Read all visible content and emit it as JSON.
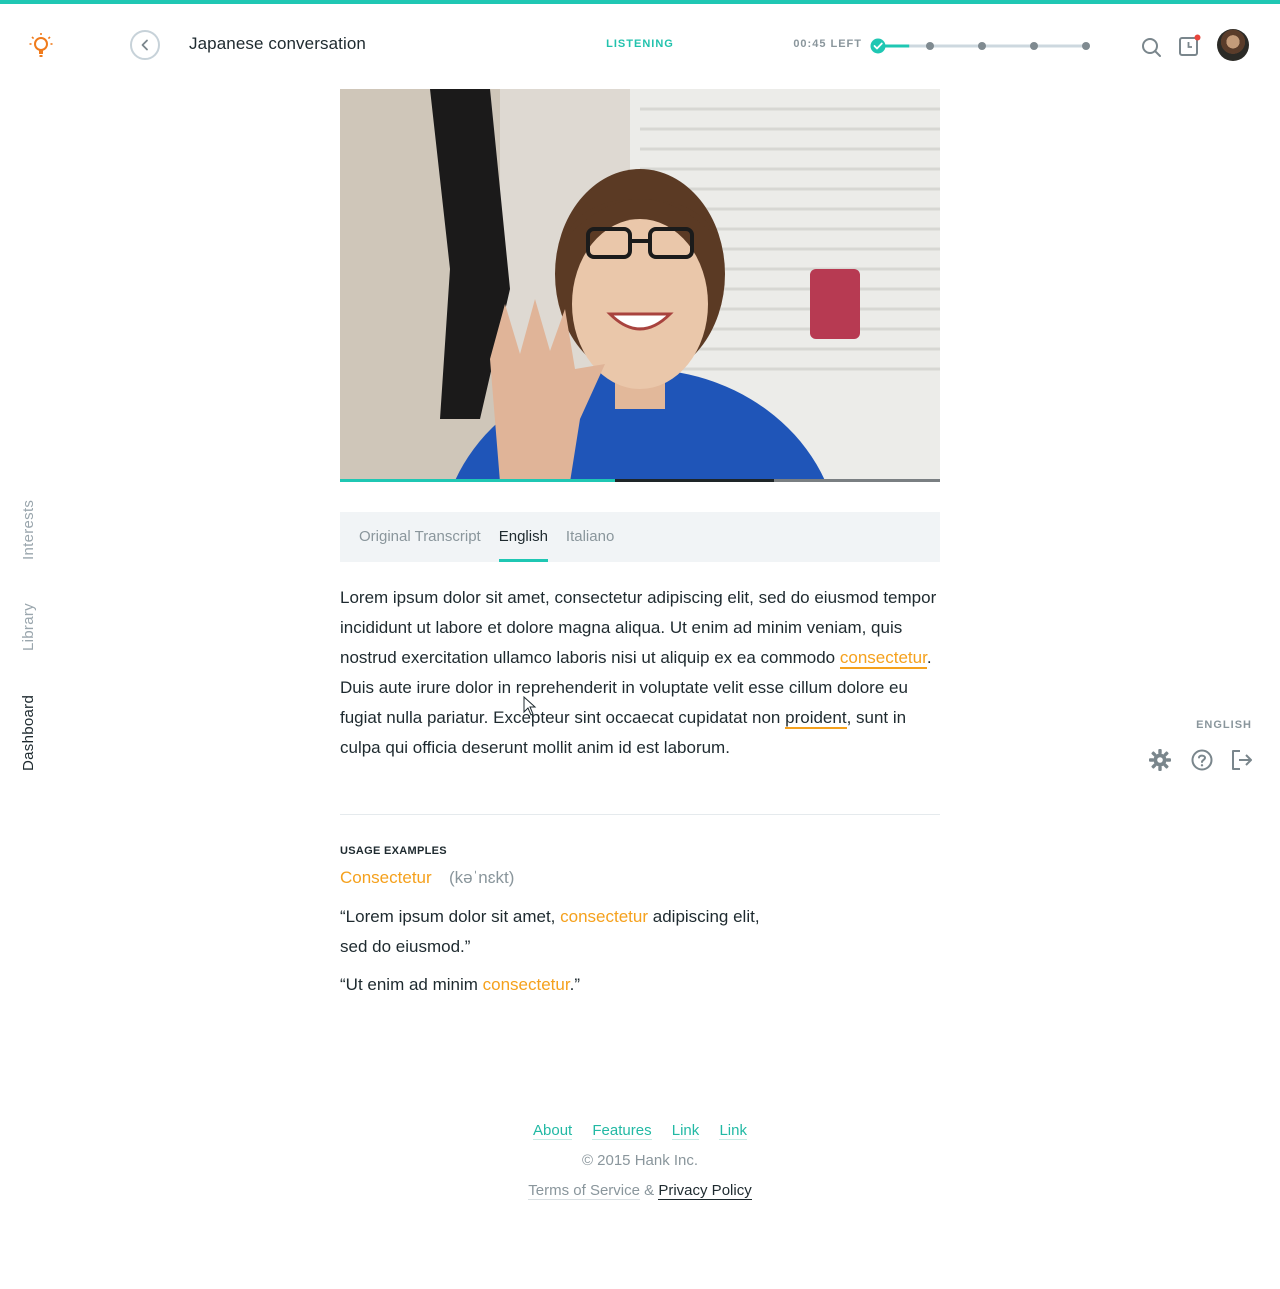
{
  "header": {
    "title": "Japanese conversation",
    "mode": "LISTENING",
    "time_left": "00:45 LEFT",
    "steps_total": 5,
    "steps_completed": 1,
    "step_progress": 0.6,
    "notification_dot": true
  },
  "colors": {
    "accent": "#1fc7b3",
    "highlight": "#f5a11d",
    "text": "#1e2a2f",
    "muted": "#8a969c",
    "notification": "#e8453c"
  },
  "icons": {
    "logo": "lightbulb-icon",
    "back": "chevron-left-icon",
    "search": "search-icon",
    "notifications": "calendar-clock-icon",
    "settings": "gear-icon",
    "help": "question-icon",
    "logout": "logout-icon"
  },
  "sidebar": {
    "items": [
      {
        "label": "Interests",
        "active": false
      },
      {
        "label": "Library",
        "active": false
      },
      {
        "label": "Dashboard",
        "active": true
      }
    ]
  },
  "utility": {
    "language": "ENGLISH"
  },
  "video": {
    "played_fraction": 0.458,
    "buffered_fraction": 0.723
  },
  "tabs": [
    {
      "label": "Original Transcript",
      "active": false
    },
    {
      "label": "English",
      "active": true
    },
    {
      "label": "Italiano",
      "active": false
    }
  ],
  "transcript": {
    "p1": "Lorem ipsum dolor sit amet, consectetur adipiscing elit, sed do eiusmod tempor incididunt ut labore et dolore magna aliqua. Ut enim ad minim veniam, quis nostrud exercitation ullamco laboris nisi ut aliquip ex ea commodo ",
    "w1": "consectetur",
    "p2": ". Duis aute irure dolor in reprehenderit in voluptate velit esse cillum dolore eu fugiat nulla pariatur. Excepteur sint occaecat cupidatat non ",
    "w2": "proident",
    "p3": ", sunt in culpa qui officia deserunt mollit anim id est laborum."
  },
  "usage": {
    "heading": "USAGE EXAMPLES",
    "word": "Consectetur",
    "phonetic": "(kəˈnɛkt)",
    "example1": {
      "before": "“Lorem ipsum dolor sit amet, ",
      "word": "consectetur",
      "after": " adipiscing elit, sed do eiusmod.”"
    },
    "example2": {
      "before": "“Ut enim ad minim ",
      "word": "consectetur",
      "after": ".”"
    }
  },
  "footer": {
    "links": [
      "About",
      "Features",
      "Link",
      "Link"
    ],
    "copyright": "© 2015 Hank Inc.",
    "tos": "Terms of Service",
    "amp": "&",
    "privacy": "Privacy Policy"
  }
}
